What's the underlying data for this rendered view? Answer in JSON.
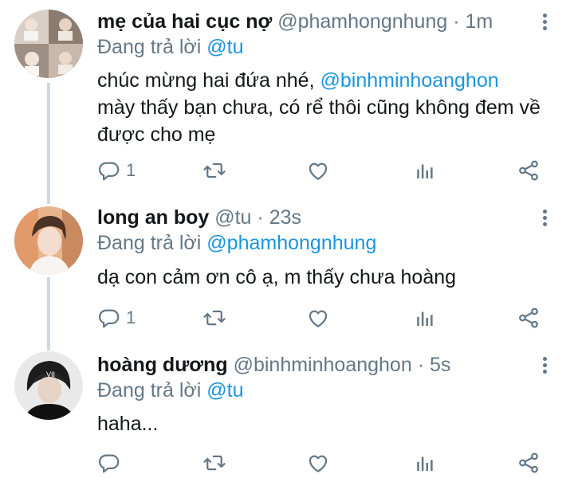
{
  "tweets": [
    {
      "name": "mẹ của hai cục nợ",
      "handle": "@phamhongnhung",
      "sep": "·",
      "time": "1m",
      "reply_prefix": "Đang trả lời",
      "reply_to": "@tu",
      "body_pre": "chúc mừng hai đứa nhé,",
      "body_mention": "@binhminhoanghon",
      "body_post": "mày thấy bạn chưa, có rể thôi cũng không đem về được cho mẹ",
      "reply_count": "1"
    },
    {
      "name": "long an boy",
      "handle": "@tu",
      "sep": "·",
      "time": "23s",
      "reply_prefix": "Đang trả lời",
      "reply_to": "@phamhongnhung",
      "body": "dạ con cảm ơn cô ạ, m thấy chưa hoàng",
      "reply_count": "1"
    },
    {
      "name": "hoàng dương",
      "handle": "@binhminhoanghon",
      "sep": "·",
      "time": "5s",
      "reply_prefix": "Đang trả lời",
      "reply_to": "@tu",
      "body": "haha...",
      "reply_count": ""
    }
  ],
  "icons": [
    "reply-icon",
    "retweet-icon",
    "like-icon",
    "analytics-icon",
    "share-icon",
    "more-options-icon"
  ],
  "colors": {
    "text": "#14171a",
    "muted": "#657786",
    "mention": "#1b95e0",
    "thread_line": "#cfd9de"
  }
}
